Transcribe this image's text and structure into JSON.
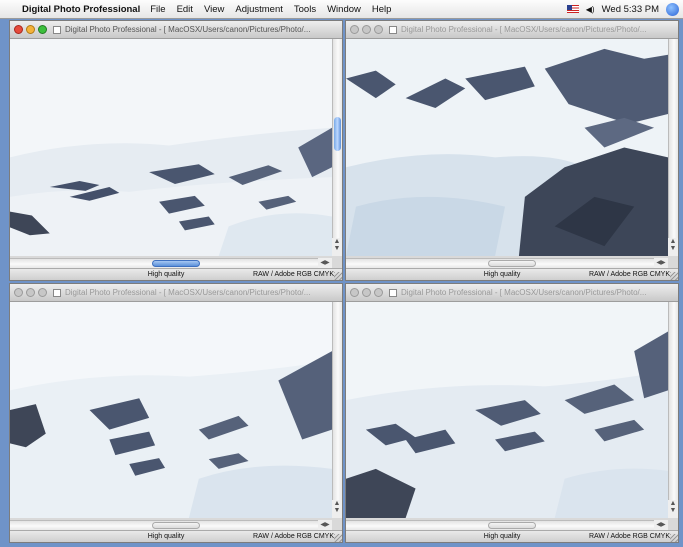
{
  "menubar": {
    "app_name": "Digital Photo Professional",
    "menus": [
      "File",
      "Edit",
      "View",
      "Adjustment",
      "Tools",
      "Window",
      "Help"
    ],
    "clock": "Wed 5:33 PM",
    "volume_glyph": "◀)"
  },
  "windows": [
    {
      "title": "Digital Photo Professional - [ MacOSX/Users/canon/Pictures/Photo/...",
      "quality": "High quality",
      "color_info": "RAW / Adobe RGB  CMYK"
    },
    {
      "title": "Digital Photo Professional - [ MacOSX/Users/canon/Pictures/Photo/...",
      "quality": "High quality",
      "color_info": "RAW / Adobe RGB  CMYK"
    },
    {
      "title": "Digital Photo Professional - [ MacOSX/Users/canon/Pictures/Photo/...",
      "quality": "High quality",
      "color_info": "RAW / Adobe RGB  CMYK"
    },
    {
      "title": "Digital Photo Professional - [ MacOSX/Users/canon/Pictures/Photo/...",
      "quality": "High quality",
      "color_info": "RAW / Adobe RGB  CMYK"
    }
  ],
  "colors": {
    "desktop": "#6f93c8",
    "rock": "#3e4657",
    "snow": "#f2f5f8",
    "selection": "#5b90da"
  }
}
